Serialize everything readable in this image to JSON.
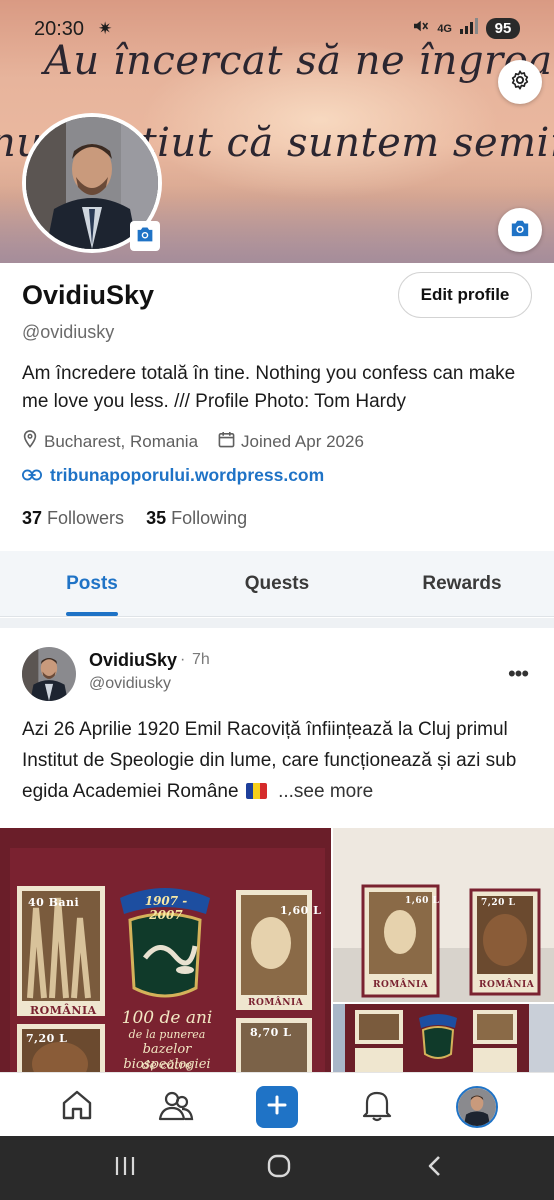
{
  "status_bar": {
    "time": "20:30",
    "weather_icon": "sun-icon",
    "network": "4G",
    "battery": "95"
  },
  "banner": {
    "line1": "Au încercat să ne îngroape,",
    "line2": "nu au știut că suntem semințe"
  },
  "profile": {
    "name": "OvidiuSky",
    "handle": "@ovidiusky",
    "edit_label": "Edit profile",
    "bio": "Am încredere totală în tine. Nothing you confess can make me love you less. /// Profile Photo: Tom Hardy",
    "location": "Bucharest, Romania",
    "joined": "Joined Apr 2026",
    "website": "tribunapoporului.wordpress.com",
    "followers_count": "37",
    "followers_label": "Followers",
    "following_count": "35",
    "following_label": "Following"
  },
  "tabs": [
    {
      "label": "Posts",
      "active": true
    },
    {
      "label": "Quests",
      "active": false
    },
    {
      "label": "Rewards",
      "active": false
    }
  ],
  "post": {
    "author": "OvidiuSky",
    "dot": "·",
    "time": "7h",
    "handle": "@ovidiusky",
    "more": "•••",
    "text": "Azi 26 Aprilie 1920 Emil Racoviță înființează la Cluj primul Institut de Speologie din lume, care funcționează și azi sub egida Academiei Române",
    "see_more": "...see more",
    "images": {
      "main": {
        "years": "1907 - 2007",
        "caption1": "100 de ani",
        "caption2": "de la punerea",
        "caption3": "bazelor biospeologiei",
        "caption4": "de către",
        "stamp1_value": "40 Bani",
        "stamp1_country": "ROMÂNIA",
        "stamp2_value": "1,60 L",
        "stamp2_country": "ROMÂNIA",
        "stamp3_value": "7,20 L",
        "stamp4_value": "8,70 L"
      },
      "top_right": {
        "stamp1_value": "1,60 L",
        "stamp1_country": "ROMÂNIA",
        "stamp2_value": "7,20 L",
        "stamp2_country": "ROMÂNIA"
      }
    }
  },
  "bottom_nav": [
    "home-icon",
    "community-icon",
    "add-icon",
    "notifications-icon",
    "profile-avatar"
  ],
  "colors": {
    "accent": "#1f73c6",
    "stamp_sheet": "#6d1f2a"
  }
}
